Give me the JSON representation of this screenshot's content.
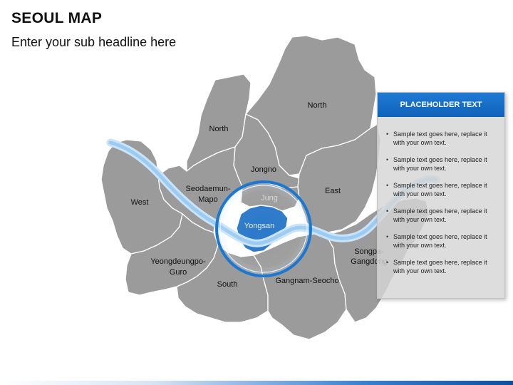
{
  "header": {
    "title": "SEOUL MAP",
    "subtitle": "Enter your sub headline here"
  },
  "map": {
    "districts": {
      "north_east": "North",
      "north_west": "North",
      "jongno": "Jongno",
      "jung": "Jung",
      "east": "East",
      "seodaemun_mapo": [
        "Seodaemun-",
        "Mapo"
      ],
      "west": "West",
      "yongsan": "Yongsan",
      "yeongdeungpo_guro": [
        "Yeongdeungpo-",
        "Guro"
      ],
      "south": "South",
      "gangnam_seocho": "Gangnam-Seocho",
      "songpa_gangdong": [
        "Songpa-",
        "Gangdong"
      ]
    },
    "colors": {
      "district_fill": "#9b9b9b",
      "district_border": "#ffffff",
      "highlight_fill": "#2b78c9",
      "river": "#a9d1f4",
      "magnifier_ring": "#1e77cf"
    }
  },
  "panel": {
    "header": "PLACEHOLDER TEXT",
    "items": [
      "Sample text goes here, replace it with your own text.",
      "Sample text goes here, replace it with your own text.",
      "Sample text goes here, replace it with your own text.",
      "Sample text goes here, replace it with your own text.",
      "Sample text goes here, replace it with your own text.",
      "Sample text goes here, replace it with your own text."
    ]
  }
}
